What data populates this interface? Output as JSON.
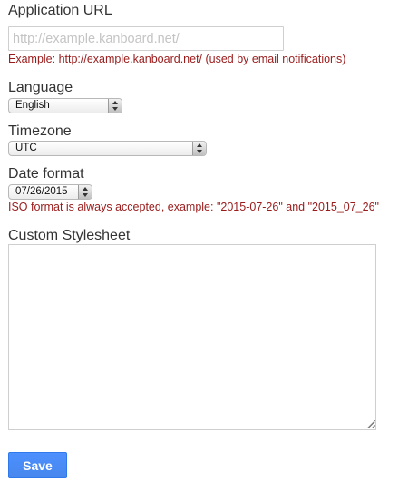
{
  "fields": {
    "application_url": {
      "label": "Application URL",
      "value": "",
      "placeholder": "http://example.kanboard.net/",
      "hint": "Example: http://example.kanboard.net/ (used by email notifications)"
    },
    "language": {
      "label": "Language",
      "selected": "English"
    },
    "timezone": {
      "label": "Timezone",
      "selected": "UTC"
    },
    "date_format": {
      "label": "Date format",
      "selected": "07/26/2015",
      "hint": "ISO format is always accepted, example: \"2015-07-26\" and \"2015_07_26\""
    },
    "custom_stylesheet": {
      "label": "Custom Stylesheet",
      "value": ""
    }
  },
  "actions": {
    "save_label": "Save"
  },
  "colors": {
    "hint_text": "#9a1b1b",
    "primary_button": "#4d90fe",
    "label_text": "#333333"
  },
  "icons": {
    "select_arrows": "updown-arrows-icon",
    "textarea_resize": "resize-grip-icon"
  }
}
